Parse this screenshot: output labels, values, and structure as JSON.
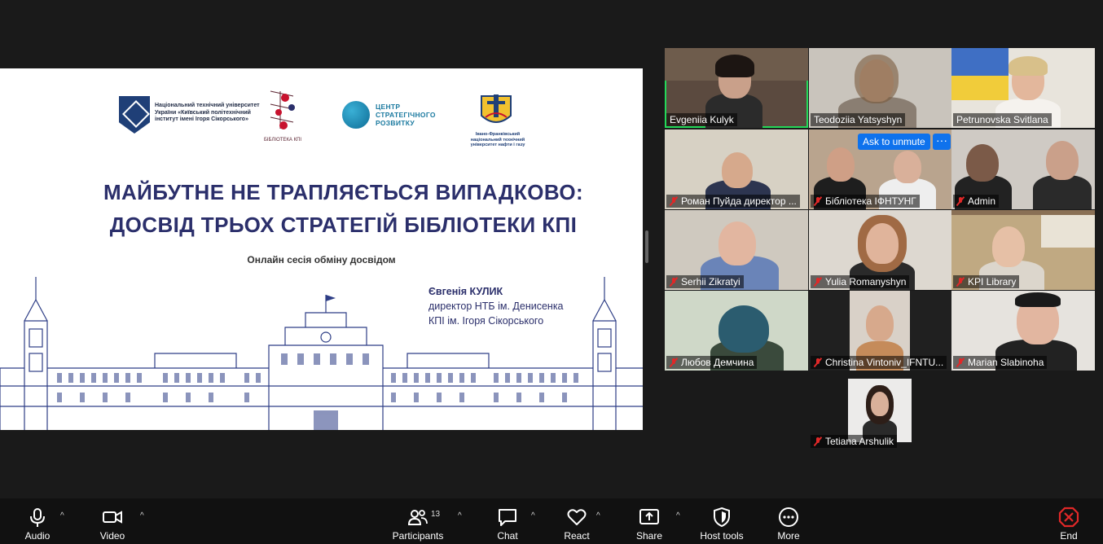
{
  "slide": {
    "kpi_logo_text": "Національний технічний університет України «Київський політехнічний інститут імені Ігоря Сікорського»",
    "library_logo_text": "БІБЛІОТЕКА КПІ",
    "center_logo_text": [
      "ЦЕНТР",
      "СТРАТЕГІЧНОГО",
      "РОЗВИТКУ"
    ],
    "ifntung_logo_text": "Івано-Франківський національний технічний університет нафти і газу",
    "title_line1": "МАЙБУТНЕ НЕ ТРАПЛЯЄТЬСЯ ВИПАДКОВО:",
    "title_line2": "ДОСВІД ТРЬОХ СТРАТЕГІЙ БІБЛІОТЕКИ КПІ",
    "subtitle": "Онлайн сесія обміну досвідом",
    "speaker_name": "Євгенія КУЛИК",
    "speaker_role": "директор НТБ ім. Денисенка",
    "speaker_org": "КПІ ім. Ігоря Сікорського"
  },
  "participants": [
    {
      "name": "Evgeniia Kulyk",
      "muted": false,
      "active": true
    },
    {
      "name": "Teodoziia Yatsyshyn",
      "muted": false,
      "active": false
    },
    {
      "name": "Petrunovska Svitlana",
      "muted": false,
      "active": false
    },
    {
      "name": "Роман Пуйда директор ...",
      "muted": true,
      "active": false
    },
    {
      "name": "Бібліотека ІФНТУНГ",
      "muted": true,
      "active": false
    },
    {
      "name": "Admin",
      "muted": true,
      "active": false
    },
    {
      "name": "Serhii Zikratyi",
      "muted": true,
      "active": false
    },
    {
      "name": "Yulia Romanyshyn",
      "muted": true,
      "active": false
    },
    {
      "name": "KPI Library",
      "muted": true,
      "active": false
    },
    {
      "name": "Любов Демчина",
      "muted": true,
      "active": false
    },
    {
      "name": "Christina Vintoniv_IFNTU...",
      "muted": true,
      "active": false
    },
    {
      "name": "Marian Slabinoha",
      "muted": true,
      "active": false
    },
    {
      "name": "Tetiana Arshulik",
      "muted": true,
      "active": false
    }
  ],
  "tile_overlay": {
    "ask_to_unmute": "Ask to unmute",
    "more": "···"
  },
  "toolbar": {
    "audio": "Audio",
    "video": "Video",
    "participants": "Participants",
    "participants_count": "13",
    "chat": "Chat",
    "react": "React",
    "share": "Share",
    "host_tools": "Host tools",
    "more": "More",
    "end": "End",
    "caret": "^"
  },
  "colors": {
    "active_speaker": "#23d959",
    "muted": "#e02828",
    "accent": "#0e72ed",
    "end": "#e02828",
    "slide_title": "#2b2f6b"
  }
}
